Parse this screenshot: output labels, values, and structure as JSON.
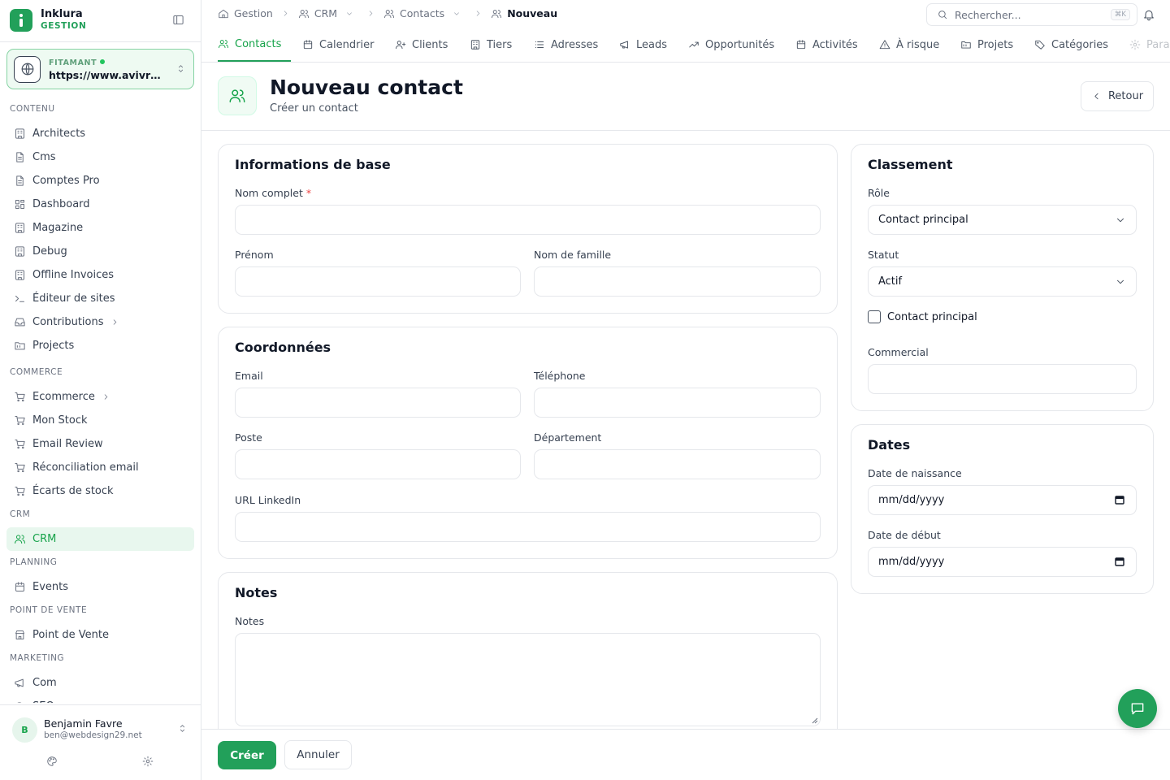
{
  "brand": {
    "name": "Inklura",
    "subtitle": "GESTION"
  },
  "site": {
    "label": "FITAMANT",
    "url": "https://www.avivre.fr"
  },
  "sidebar": {
    "sections": [
      {
        "title": "CONTENU",
        "items": [
          {
            "label": "Architects",
            "icon": "building-icon"
          },
          {
            "label": "Cms",
            "icon": "file-icon"
          },
          {
            "label": "Comptes Pro",
            "icon": "file-icon"
          },
          {
            "label": "Dashboard",
            "icon": "grid-icon"
          },
          {
            "label": "Magazine",
            "icon": "building-icon"
          },
          {
            "label": "Debug",
            "icon": "building-icon"
          },
          {
            "label": "Offline Invoices",
            "icon": "building-icon"
          },
          {
            "label": "Éditeur de sites",
            "icon": "terminal-icon"
          },
          {
            "label": "Contributions",
            "icon": "inbox-icon",
            "chevron": true
          },
          {
            "label": "Projects",
            "icon": "folder-icon"
          }
        ]
      },
      {
        "title": "COMMERCE",
        "items": [
          {
            "label": "Ecommerce",
            "icon": "cart-icon",
            "chevron": true
          },
          {
            "label": "Mon Stock",
            "icon": "cart-icon"
          },
          {
            "label": "Email Review",
            "icon": "cart-icon"
          },
          {
            "label": "Réconciliation email",
            "icon": "cart-icon"
          },
          {
            "label": "Écarts de stock",
            "icon": "cart-icon"
          }
        ]
      },
      {
        "title": "CRM",
        "items": [
          {
            "label": "CRM",
            "icon": "users-icon",
            "active": true
          }
        ]
      },
      {
        "title": "PLANNING",
        "items": [
          {
            "label": "Events",
            "icon": "calendar-icon"
          }
        ]
      },
      {
        "title": "POINT DE VENTE",
        "items": [
          {
            "label": "Point de Vente",
            "icon": "store-icon"
          }
        ]
      },
      {
        "title": "MARKETING",
        "items": [
          {
            "label": "Com",
            "icon": "megaphone-icon"
          },
          {
            "label": "SEO",
            "icon": "search-icon"
          }
        ]
      }
    ]
  },
  "user": {
    "initial": "B",
    "name": "Benjamin Favre",
    "email": "ben@webdesign29.net"
  },
  "breadcrumb": [
    "Gestion",
    "CRM",
    "Contacts",
    "Nouveau"
  ],
  "search": {
    "placeholder": "Rechercher...",
    "shortcut": "⌘K"
  },
  "tabs": [
    {
      "label": "Contacts",
      "icon": "users-icon",
      "active": true
    },
    {
      "label": "Calendrier",
      "icon": "calendar-icon"
    },
    {
      "label": "Clients",
      "icon": "user-plus-icon"
    },
    {
      "label": "Tiers",
      "icon": "building-icon"
    },
    {
      "label": "Adresses",
      "icon": "list-icon"
    },
    {
      "label": "Leads",
      "icon": "megaphone-icon"
    },
    {
      "label": "Opportunités",
      "icon": "trending-icon"
    },
    {
      "label": "Activités",
      "icon": "calendar-icon"
    },
    {
      "label": "À risque",
      "icon": "warning-icon"
    },
    {
      "label": "Projets",
      "icon": "folder-icon"
    },
    {
      "label": "Catégories",
      "icon": "tag-icon"
    },
    {
      "label": "Paramètres",
      "icon": "gear-icon"
    }
  ],
  "page": {
    "title": "Nouveau contact",
    "subtitle": "Créer un contact",
    "back_label": "Retour"
  },
  "basic": {
    "title": "Informations de base",
    "full_name_label": "Nom complet",
    "required_mark": "*",
    "first_name_label": "Prénom",
    "last_name_label": "Nom de famille"
  },
  "contact": {
    "title": "Coordonnées",
    "email_label": "Email",
    "phone_label": "Téléphone",
    "position_label": "Poste",
    "department_label": "Département",
    "linkedin_label": "URL LinkedIn"
  },
  "notes": {
    "title": "Notes",
    "label": "Notes"
  },
  "classement": {
    "title": "Classement",
    "role_label": "Rôle",
    "role_value": "Contact principal",
    "status_label": "Statut",
    "status_value": "Actif",
    "primary_checkbox_label": "Contact principal",
    "commercial_label": "Commercial"
  },
  "dates": {
    "title": "Dates",
    "birth_label": "Date de naissance",
    "start_label": "Date de début",
    "placeholder": "mm/dd/yyyy"
  },
  "actions": {
    "create_label": "Créer",
    "cancel_label": "Annuler"
  },
  "colors": {
    "accent": "#22a05a",
    "accent_light": "#e8f7ee",
    "border": "#e5e7eb"
  }
}
